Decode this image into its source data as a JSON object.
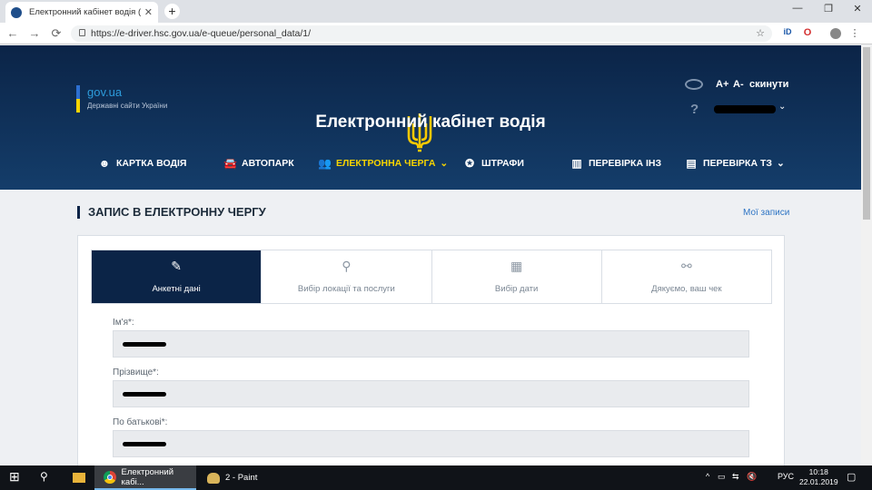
{
  "browser": {
    "tab_title": "Електронний кабінет водія (Дос",
    "new_tab": "+",
    "url": "https://e-driver.hsc.gov.ua/e-queue/personal_data/1/",
    "window_controls": [
      "—",
      "❐",
      "✕"
    ],
    "nav_icons": [
      "←",
      "→",
      "⟳"
    ],
    "ext_icons": [
      "☆",
      "iD",
      "O",
      "⋮"
    ]
  },
  "header": {
    "gov_logo": "gov.ua",
    "gov_subtitle": "Державні сайти України",
    "title": "Електронний кабінет водія",
    "accessibility": {
      "increase": "A+",
      "decrease": "A-",
      "reset": "скинути"
    },
    "help": "?",
    "user_chevron": "⌄"
  },
  "menu": [
    {
      "label": "КАРТКА ВОДІЯ",
      "icon": "id-card-icon",
      "glyph": "☻"
    },
    {
      "label": "АВТОПАРК",
      "icon": "car-icon",
      "glyph": "🚘"
    },
    {
      "label": "ЕЛЕКТРОННА ЧЕРГА",
      "icon": "queue-icon",
      "glyph": "👥",
      "active": true,
      "chevron": "⌄"
    },
    {
      "label": "ШТРАФИ",
      "icon": "fine-icon",
      "glyph": "✪"
    },
    {
      "label": "ПЕРЕВІРКА ІНЗ",
      "icon": "barcode-icon",
      "glyph": "▥"
    },
    {
      "label": "ПЕРЕВІРКА ТЗ",
      "icon": "document-icon",
      "glyph": "▤",
      "chevron": "⌄"
    }
  ],
  "page": {
    "heading": "ЗАПИС В ЕЛЕКТРОННУ ЧЕРГУ",
    "my_records": "Мої записи"
  },
  "steps": [
    {
      "label": "Анкетні дані",
      "icon": "edit-icon",
      "glyph": "✎",
      "active": true
    },
    {
      "label": "Вибір локації та послуги",
      "icon": "location-pin-icon",
      "glyph": "⚲"
    },
    {
      "label": "Вибір дати",
      "icon": "calendar-icon",
      "glyph": "▦"
    },
    {
      "label": "Дякуємо, ваш чек",
      "icon": "link-icon",
      "glyph": "⚯"
    }
  ],
  "form": {
    "first_name_label": "Ім'я*:",
    "last_name_label": "Прізвище*:",
    "patronymic_label": "По батькові*:"
  },
  "taskbar": {
    "start": "⊞",
    "search": "⚲",
    "tasks": [
      {
        "label": "Електронний кабі...",
        "app": "chrome"
      },
      {
        "label": "2 - Paint",
        "app": "paint"
      }
    ],
    "tray": [
      "^",
      "▭",
      "⇆",
      "🔇",
      "РУС"
    ],
    "time": "10:18",
    "date": "22.01.2019",
    "notifications": "▢"
  },
  "colors": {
    "header_dark": "#0b2447",
    "accent_yellow": "#f7d400",
    "link_blue": "#2d74c4",
    "gov_blue": "#2d9cdb"
  }
}
